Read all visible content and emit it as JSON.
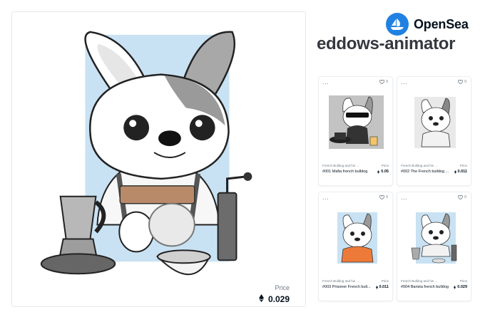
{
  "brand": {
    "name": "OpenSea",
    "color": "#2081e2"
  },
  "collection": {
    "title": "eddows-animator"
  },
  "featured": {
    "price_label": "Price",
    "price": "0.029",
    "currency_icon": "eth-icon"
  },
  "cards": [
    {
      "collection": "French Bulldog and his ...",
      "name": "#001 Mafia french bulldog",
      "price_label": "Price",
      "price": "0.05",
      "favorites": "0",
      "menu": "..."
    },
    {
      "collection": "French Bulldog and his ...",
      "name": "#002 The French bulldog ...",
      "price_label": "Price",
      "price": "0.011",
      "favorites": "0",
      "menu": "..."
    },
    {
      "collection": "French Bulldog and his ...",
      "name": "#003 Prisoner French bull...",
      "price_label": "Price",
      "price": "0.011",
      "favorites": "0",
      "menu": "..."
    },
    {
      "collection": "French Bulldog and his ...",
      "name": "#004 Barista french bulldog",
      "price_label": "Price",
      "price": "0.029",
      "favorites": "0",
      "menu": "..."
    }
  ],
  "colors": {
    "accent": "#2081e2",
    "artwork_background": "#c9e2f3",
    "text": "#04111d",
    "muted": "#707a83"
  }
}
